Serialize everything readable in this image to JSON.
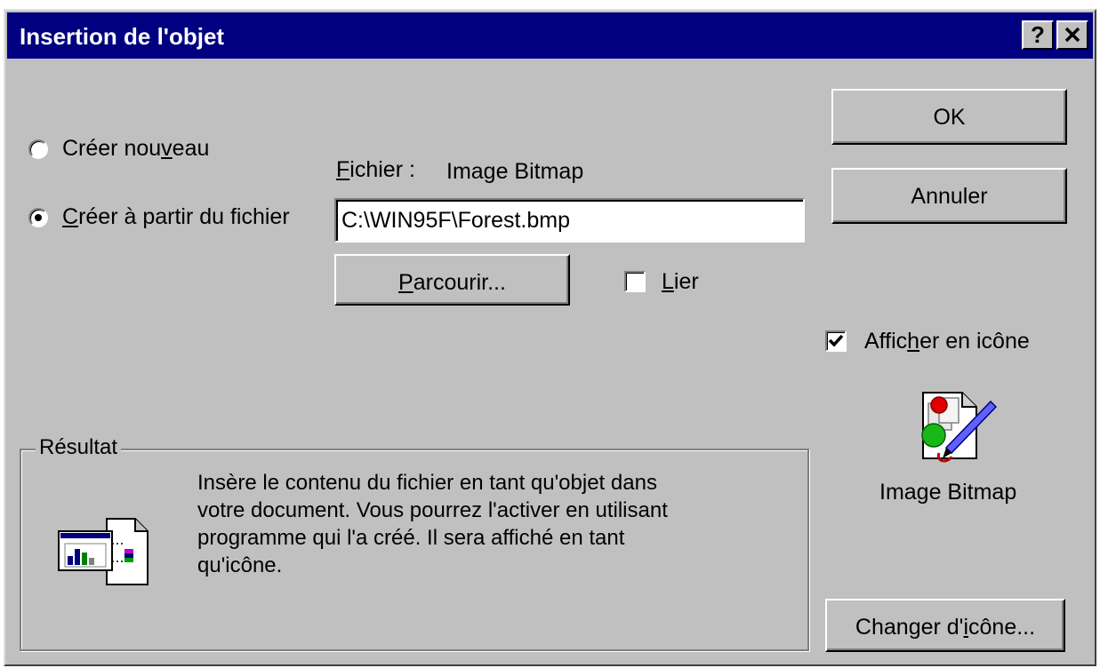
{
  "window": {
    "title": "Insertion de l'objet",
    "help_button": "?",
    "close_button": "✕"
  },
  "options": {
    "create_new": {
      "label_pre": "Créer nou",
      "label_key": "v",
      "label_post": "eau",
      "selected": false
    },
    "create_from_file": {
      "label_pre": "",
      "label_key": "C",
      "label_post": "réer à partir du fichier",
      "selected": true
    }
  },
  "file": {
    "label_key": "F",
    "label_post": "ichier :",
    "type": "Image Bitmap",
    "path": "C:\\WIN95F\\Forest.bmp"
  },
  "browse_button": {
    "key": "P",
    "post": "arcourir..."
  },
  "link_checkbox": {
    "key": "L",
    "post": "ier",
    "checked": false
  },
  "ok_button": "OK",
  "cancel_button": "Annuler",
  "display_as_icon": {
    "pre": "Affic",
    "key": "h",
    "post": "er en icône",
    "checked": true
  },
  "icon_caption": "Image Bitmap",
  "change_icon_button": {
    "pre": "Changer d'",
    "key": "i",
    "post": "cône..."
  },
  "result": {
    "title": "Résultat",
    "lines": [
      "Insère le contenu du fichier en tant qu'objet dans",
      "votre document. Vous pourrez l'activer en utilisant",
      "programme qui l'a créé. Il sera affiché en tant",
      "qu'icône."
    ]
  },
  "colors": {
    "titlebar": "#000080",
    "dialog_face": "#c0c0c0"
  }
}
